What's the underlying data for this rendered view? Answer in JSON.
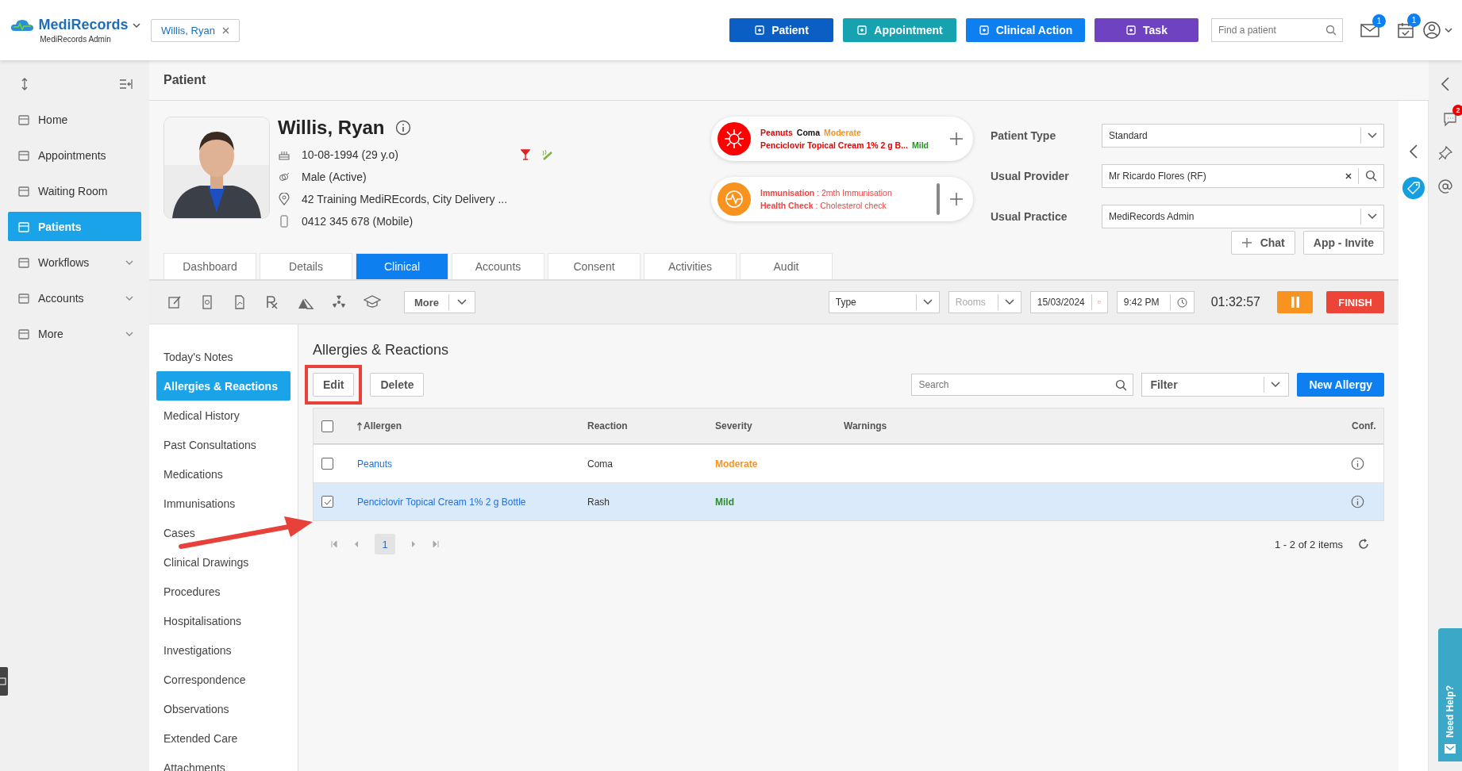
{
  "header": {
    "logo": "MediRecords",
    "subtitle": "MediRecords Admin",
    "open_patient": "Willis, Ryan",
    "actions": [
      {
        "label": "Patient",
        "color": "#0b5fc4"
      },
      {
        "label": "Appointment",
        "color": "#17a2b0"
      },
      {
        "label": "Clinical Action",
        "color": "#0d7ff0"
      },
      {
        "label": "Task",
        "color": "#6f42c1"
      }
    ],
    "search": {
      "placeholder": "Find a patient"
    },
    "mail_badge": "1",
    "calendar_badge": "1"
  },
  "sidebar": {
    "items": [
      {
        "label": "Home",
        "selected": false,
        "expandable": false
      },
      {
        "label": "Appointments",
        "selected": false,
        "expandable": false
      },
      {
        "label": "Waiting Room",
        "selected": false,
        "expandable": false
      },
      {
        "label": "Patients",
        "selected": true,
        "expandable": false
      },
      {
        "label": "Workflows",
        "selected": false,
        "expandable": true
      },
      {
        "label": "Accounts",
        "selected": false,
        "expandable": true
      },
      {
        "label": "More",
        "selected": false,
        "expandable": true
      }
    ]
  },
  "page_title": "Patient",
  "patient": {
    "name": "Willis, Ryan",
    "details": [
      {
        "kind": "dob",
        "text": "10-08-1994 (29 y.o)"
      },
      {
        "kind": "gender",
        "text": "Male (Active)"
      },
      {
        "kind": "address",
        "text": "42 Training MediREcords, City Delivery ..."
      },
      {
        "kind": "phone",
        "text": "0412 345 678 (Mobile)"
      }
    ]
  },
  "allergy_alert": {
    "lines": [
      {
        "allergen": "Peanuts",
        "reaction": "Coma",
        "severity": "Moderate",
        "color": "#f7931e"
      },
      {
        "allergen": "Penciclovir Topical Cream 1% 2 g B...",
        "severity": "Mild",
        "color": "#2e8b2e"
      }
    ]
  },
  "reminder_alert": {
    "lines": [
      "**Immunisation** : 2mth Immunisation",
      "**Health Check** : Cholesterol check"
    ]
  },
  "patient_fields": [
    {
      "label": "Patient Type",
      "value": "Standard",
      "kind": "select"
    },
    {
      "label": "Usual Provider",
      "value": "Mr Ricardo Flores (RF)",
      "kind": "lookup"
    },
    {
      "label": "Usual Practice",
      "value": "MediRecords Admin",
      "kind": "select"
    }
  ],
  "chat_button": "Chat",
  "invite_button": "App - Invite",
  "tabs": [
    {
      "label": "Dashboard",
      "selected": false
    },
    {
      "label": "Details",
      "selected": false
    },
    {
      "label": "Clinical",
      "selected": true
    },
    {
      "label": "Accounts",
      "selected": false
    },
    {
      "label": "Consent",
      "selected": false
    },
    {
      "label": "Activities",
      "selected": false
    },
    {
      "label": "Audit",
      "selected": false
    }
  ],
  "toolbar": {
    "more": "More",
    "type": {
      "placeholder": "Type"
    },
    "rooms": {
      "placeholder": "Rooms"
    },
    "date": "15/03/2024",
    "time": "9:42 PM",
    "timer": "01:32:57",
    "finish": "FINISH"
  },
  "clinical_nav": [
    {
      "label": "Today's Notes",
      "selected": false
    },
    {
      "label": "Allergies & Reactions",
      "selected": true
    },
    {
      "label": "Medical History",
      "selected": false
    },
    {
      "label": "Past Consultations",
      "selected": false
    },
    {
      "label": "Medications",
      "selected": false
    },
    {
      "label": "Immunisations",
      "selected": false
    },
    {
      "label": "Cases",
      "selected": false
    },
    {
      "label": "Clinical Drawings",
      "selected": false
    },
    {
      "label": "Procedures",
      "selected": false
    },
    {
      "label": "Hospitalisations",
      "selected": false
    },
    {
      "label": "Investigations",
      "selected": false
    },
    {
      "label": "Correspondence",
      "selected": false
    },
    {
      "label": "Observations",
      "selected": false
    },
    {
      "label": "Extended Care",
      "selected": false
    },
    {
      "label": "Attachments",
      "selected": false
    }
  ],
  "section": {
    "title": "Allergies & Reactions",
    "edit": "Edit",
    "delete": "Delete",
    "search": {
      "placeholder": "Search"
    },
    "filter": "Filter",
    "new": "New Allergy"
  },
  "table": {
    "columns": [
      "Allergen",
      "Reaction",
      "Severity",
      "Warnings",
      "Conf."
    ],
    "all_checked": false,
    "rows": [
      {
        "allergen": "Peanuts",
        "reaction": "Coma",
        "severity": "Moderate",
        "color": "#f7931e",
        "checked": false,
        "selected": false
      },
      {
        "allergen": "Penciclovir Topical Cream 1% 2 g Bottle",
        "reaction": "Rash",
        "severity": "Mild",
        "color": "#2e8b2e",
        "checked": true,
        "selected": true
      }
    ]
  },
  "pager": {
    "pages": [
      {
        "label": "1",
        "selected": true
      }
    ],
    "summary": "1 - 2 of 2 items"
  },
  "right_rail": {
    "chat_badge": "2",
    "help": "Need Help?"
  }
}
